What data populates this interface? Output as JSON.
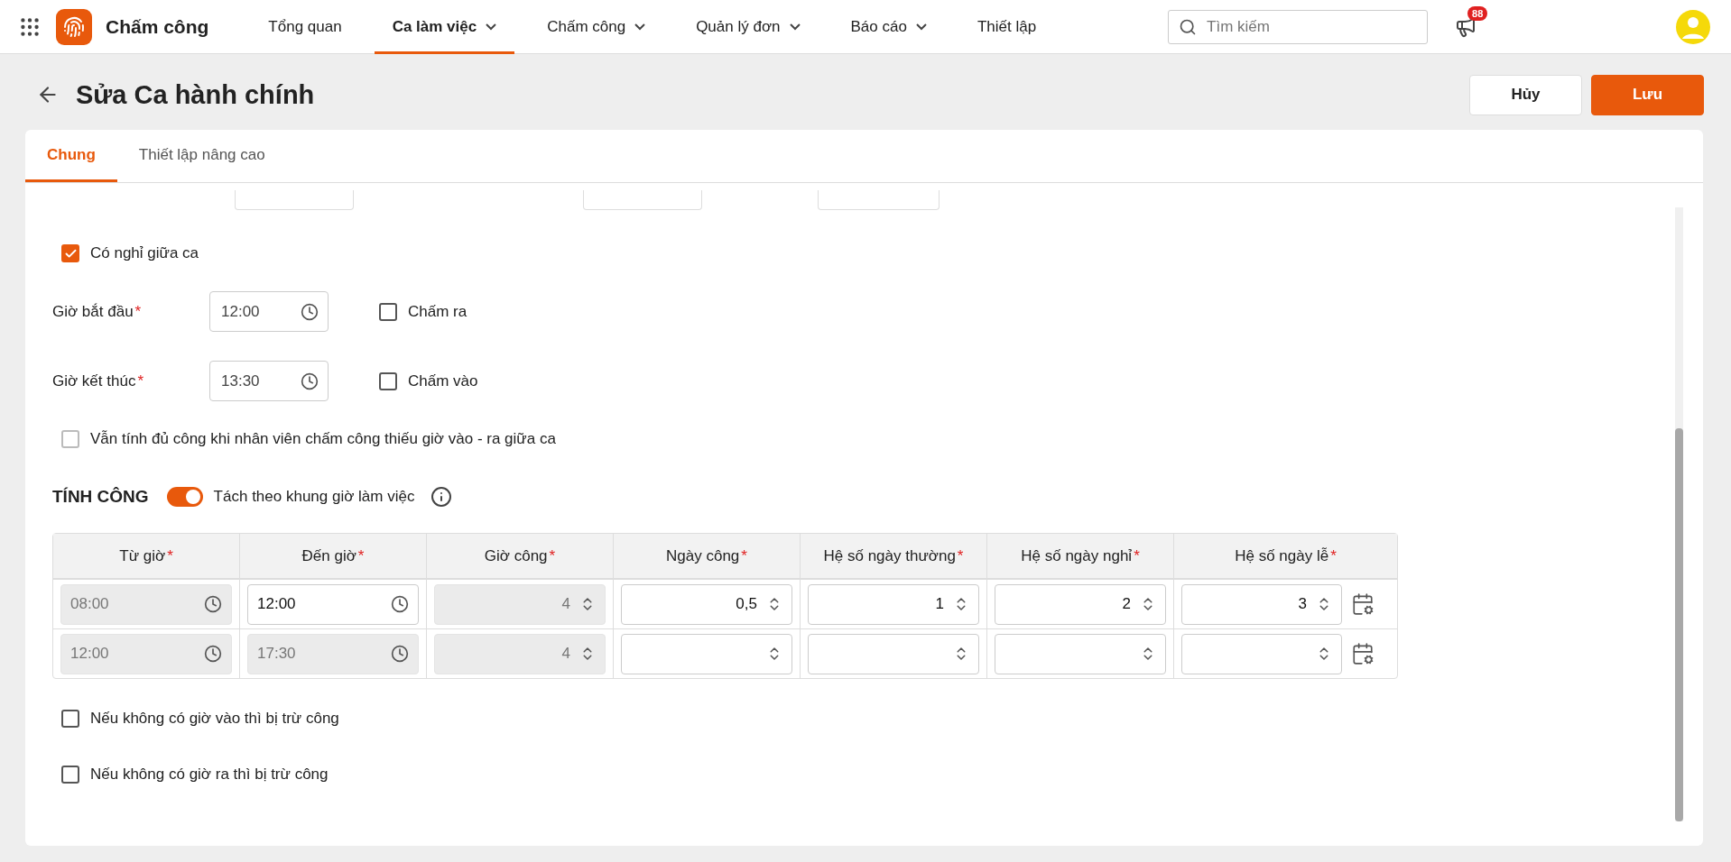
{
  "app": {
    "title": "Chấm công",
    "notification_count": "88"
  },
  "nav": [
    {
      "label": "Tổng quan",
      "has_dropdown": false,
      "selected": false
    },
    {
      "label": "Ca làm việc",
      "has_dropdown": true,
      "selected": true
    },
    {
      "label": "Chấm công",
      "has_dropdown": true,
      "selected": false
    },
    {
      "label": "Quản lý đơn",
      "has_dropdown": true,
      "selected": false
    },
    {
      "label": "Báo cáo",
      "has_dropdown": true,
      "selected": false
    },
    {
      "label": "Thiết lập",
      "has_dropdown": false,
      "selected": false
    }
  ],
  "search": {
    "placeholder": "Tìm kiếm"
  },
  "page": {
    "title": "Sửa Ca hành chính"
  },
  "buttons": [
    {
      "label": "Hủy",
      "kind": "secondary"
    },
    {
      "label": "Lưu",
      "kind": "primary"
    }
  ],
  "tabs": [
    {
      "label": "Chung",
      "selected": true
    },
    {
      "label": "Thiết lập nâng cao",
      "selected": false
    }
  ],
  "break": {
    "label": "Có nghỉ giữa ca",
    "checked": true
  },
  "break_times": [
    {
      "label": "Giờ bắt đầu",
      "required_mark": "*",
      "value": "12:00",
      "checkbox_label": "Chấm ra",
      "checked": false
    },
    {
      "label": "Giờ kết thúc",
      "required_mark": "*",
      "value": "13:30",
      "checkbox_label": "Chấm vào",
      "checked": false
    }
  ],
  "full_credit": {
    "label": "Vẫn tính đủ công khi nhân viên chấm công thiếu giờ vào - ra giữa ca",
    "checked": false
  },
  "section": {
    "title": "TÍNH CÔNG",
    "toggle": {
      "label": "Tách theo khung giờ làm việc",
      "on": true
    }
  },
  "table": {
    "columns": [
      {
        "label": "Từ giờ",
        "required_mark": "*"
      },
      {
        "label": "Đến giờ",
        "required_mark": "*"
      },
      {
        "label": "Giờ công",
        "required_mark": "*"
      },
      {
        "label": "Ngày công",
        "required_mark": "*"
      },
      {
        "label": "Hệ số ngày thường",
        "required_mark": "*"
      },
      {
        "label": "Hệ số ngày nghỉ",
        "required_mark": "*"
      },
      {
        "label": "Hệ số ngày lễ",
        "required_mark": "*"
      }
    ],
    "rows": [
      {
        "cells": [
          {
            "kind": "time",
            "value": "08:00",
            "disabled": true
          },
          {
            "kind": "time",
            "value": "12:00",
            "disabled": false
          },
          {
            "kind": "number",
            "value": "4",
            "disabled": true
          },
          {
            "kind": "number",
            "value": "0,5",
            "disabled": false
          },
          {
            "kind": "number",
            "value": "1",
            "disabled": false
          },
          {
            "kind": "number",
            "value": "2",
            "disabled": false
          },
          {
            "kind": "number",
            "value": "3",
            "disabled": false
          }
        ]
      },
      {
        "cells": [
          {
            "kind": "time",
            "value": "12:00",
            "disabled": true
          },
          {
            "kind": "time",
            "value": "17:30",
            "disabled": true
          },
          {
            "kind": "number",
            "value": "4",
            "disabled": true
          },
          {
            "kind": "number",
            "disabled": false
          },
          {
            "kind": "number",
            "disabled": false
          },
          {
            "kind": "number",
            "disabled": false
          },
          {
            "kind": "number",
            "disabled": false
          }
        ]
      }
    ]
  },
  "deductions": [
    {
      "label": "Nếu không có giờ vào thì bị trừ công",
      "checked": false
    },
    {
      "label": "Nếu không có giờ ra thì bị trừ công",
      "checked": false
    }
  ]
}
